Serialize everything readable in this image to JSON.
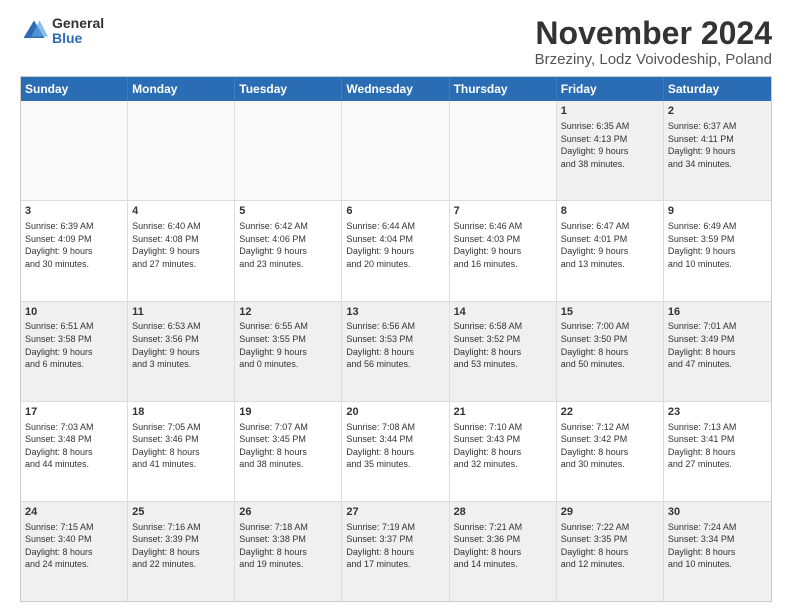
{
  "logo": {
    "general": "General",
    "blue": "Blue"
  },
  "title": "November 2024",
  "subtitle": "Brzeziny, Lodz Voivodeship, Poland",
  "headers": [
    "Sunday",
    "Monday",
    "Tuesday",
    "Wednesday",
    "Thursday",
    "Friday",
    "Saturday"
  ],
  "rows": [
    [
      {
        "day": "",
        "text": ""
      },
      {
        "day": "",
        "text": ""
      },
      {
        "day": "",
        "text": ""
      },
      {
        "day": "",
        "text": ""
      },
      {
        "day": "",
        "text": ""
      },
      {
        "day": "1",
        "text": "Sunrise: 6:35 AM\nSunset: 4:13 PM\nDaylight: 9 hours\nand 38 minutes."
      },
      {
        "day": "2",
        "text": "Sunrise: 6:37 AM\nSunset: 4:11 PM\nDaylight: 9 hours\nand 34 minutes."
      }
    ],
    [
      {
        "day": "3",
        "text": "Sunrise: 6:39 AM\nSunset: 4:09 PM\nDaylight: 9 hours\nand 30 minutes."
      },
      {
        "day": "4",
        "text": "Sunrise: 6:40 AM\nSunset: 4:08 PM\nDaylight: 9 hours\nand 27 minutes."
      },
      {
        "day": "5",
        "text": "Sunrise: 6:42 AM\nSunset: 4:06 PM\nDaylight: 9 hours\nand 23 minutes."
      },
      {
        "day": "6",
        "text": "Sunrise: 6:44 AM\nSunset: 4:04 PM\nDaylight: 9 hours\nand 20 minutes."
      },
      {
        "day": "7",
        "text": "Sunrise: 6:46 AM\nSunset: 4:03 PM\nDaylight: 9 hours\nand 16 minutes."
      },
      {
        "day": "8",
        "text": "Sunrise: 6:47 AM\nSunset: 4:01 PM\nDaylight: 9 hours\nand 13 minutes."
      },
      {
        "day": "9",
        "text": "Sunrise: 6:49 AM\nSunset: 3:59 PM\nDaylight: 9 hours\nand 10 minutes."
      }
    ],
    [
      {
        "day": "10",
        "text": "Sunrise: 6:51 AM\nSunset: 3:58 PM\nDaylight: 9 hours\nand 6 minutes."
      },
      {
        "day": "11",
        "text": "Sunrise: 6:53 AM\nSunset: 3:56 PM\nDaylight: 9 hours\nand 3 minutes."
      },
      {
        "day": "12",
        "text": "Sunrise: 6:55 AM\nSunset: 3:55 PM\nDaylight: 9 hours\nand 0 minutes."
      },
      {
        "day": "13",
        "text": "Sunrise: 6:56 AM\nSunset: 3:53 PM\nDaylight: 8 hours\nand 56 minutes."
      },
      {
        "day": "14",
        "text": "Sunrise: 6:58 AM\nSunset: 3:52 PM\nDaylight: 8 hours\nand 53 minutes."
      },
      {
        "day": "15",
        "text": "Sunrise: 7:00 AM\nSunset: 3:50 PM\nDaylight: 8 hours\nand 50 minutes."
      },
      {
        "day": "16",
        "text": "Sunrise: 7:01 AM\nSunset: 3:49 PM\nDaylight: 8 hours\nand 47 minutes."
      }
    ],
    [
      {
        "day": "17",
        "text": "Sunrise: 7:03 AM\nSunset: 3:48 PM\nDaylight: 8 hours\nand 44 minutes."
      },
      {
        "day": "18",
        "text": "Sunrise: 7:05 AM\nSunset: 3:46 PM\nDaylight: 8 hours\nand 41 minutes."
      },
      {
        "day": "19",
        "text": "Sunrise: 7:07 AM\nSunset: 3:45 PM\nDaylight: 8 hours\nand 38 minutes."
      },
      {
        "day": "20",
        "text": "Sunrise: 7:08 AM\nSunset: 3:44 PM\nDaylight: 8 hours\nand 35 minutes."
      },
      {
        "day": "21",
        "text": "Sunrise: 7:10 AM\nSunset: 3:43 PM\nDaylight: 8 hours\nand 32 minutes."
      },
      {
        "day": "22",
        "text": "Sunrise: 7:12 AM\nSunset: 3:42 PM\nDaylight: 8 hours\nand 30 minutes."
      },
      {
        "day": "23",
        "text": "Sunrise: 7:13 AM\nSunset: 3:41 PM\nDaylight: 8 hours\nand 27 minutes."
      }
    ],
    [
      {
        "day": "24",
        "text": "Sunrise: 7:15 AM\nSunset: 3:40 PM\nDaylight: 8 hours\nand 24 minutes."
      },
      {
        "day": "25",
        "text": "Sunrise: 7:16 AM\nSunset: 3:39 PM\nDaylight: 8 hours\nand 22 minutes."
      },
      {
        "day": "26",
        "text": "Sunrise: 7:18 AM\nSunset: 3:38 PM\nDaylight: 8 hours\nand 19 minutes."
      },
      {
        "day": "27",
        "text": "Sunrise: 7:19 AM\nSunset: 3:37 PM\nDaylight: 8 hours\nand 17 minutes."
      },
      {
        "day": "28",
        "text": "Sunrise: 7:21 AM\nSunset: 3:36 PM\nDaylight: 8 hours\nand 14 minutes."
      },
      {
        "day": "29",
        "text": "Sunrise: 7:22 AM\nSunset: 3:35 PM\nDaylight: 8 hours\nand 12 minutes."
      },
      {
        "day": "30",
        "text": "Sunrise: 7:24 AM\nSunset: 3:34 PM\nDaylight: 8 hours\nand 10 minutes."
      }
    ]
  ]
}
